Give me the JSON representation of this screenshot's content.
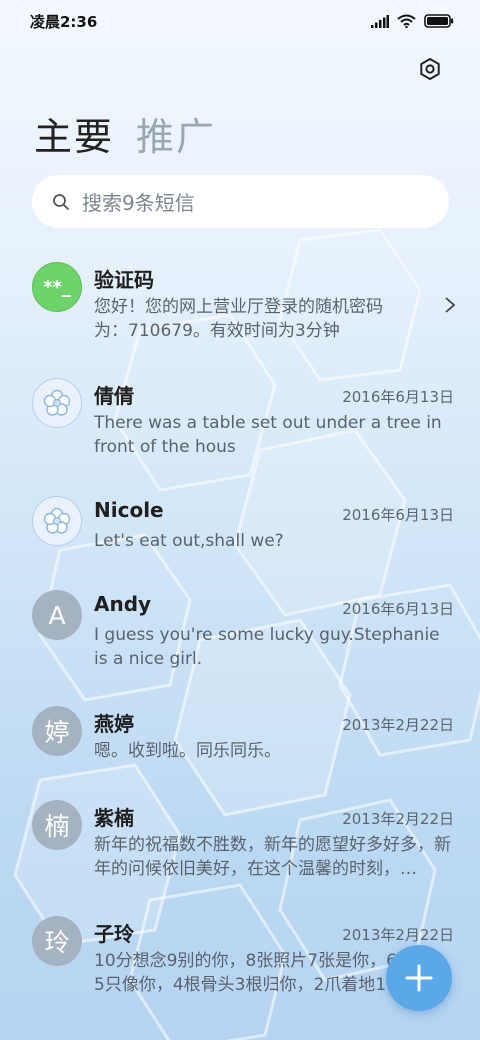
{
  "status_bar": {
    "time": "凌晨2:36"
  },
  "tabs": [
    {
      "label": "主要"
    },
    {
      "label": "推广"
    }
  ],
  "search": {
    "placeholder": "搜索9条短信"
  },
  "conversations": [
    {
      "name": "验证码",
      "date": "",
      "preview": "您好！您的网上营业厅登录的随机密码为：710679。有效时间为3分钟",
      "avatar": "**_"
    },
    {
      "name": "倩倩",
      "date": "2016年6月13日",
      "preview": "There was a table set out under a tree in front of the hous",
      "avatar": "flower-icon"
    },
    {
      "name": "Nicole",
      "date": "2016年6月13日",
      "preview": "Let's eat out,shall we?",
      "avatar": "flower-icon"
    },
    {
      "name": "Andy",
      "date": "2016年6月13日",
      "preview": "I guess you're some lucky guy.Stephanie is a nice girl.",
      "avatar": "A"
    },
    {
      "name": "燕婷",
      "date": "2013年2月22日",
      "preview": "嗯。收到啦。同乐同乐。",
      "avatar": "婷"
    },
    {
      "name": "紫楠",
      "date": "2013年2月22日",
      "preview": "新年的祝福数不胜数，新年的愿望好多好多，新年的问候依旧美好，在这个温馨的时刻，…",
      "avatar": "楠"
    },
    {
      "name": "子玲",
      "date": "2013年2月22日",
      "preview": "10分想念9别的你，8张照片7张是你，6",
      "preview2": "5只像你，4根骨头3根归你，2爪着地1",
      "avatar": "玲"
    }
  ],
  "colors": {
    "accent": "#5ba8e8",
    "green_avatar": "#6dd36a",
    "letter_avatar": "#a4b2c1"
  }
}
